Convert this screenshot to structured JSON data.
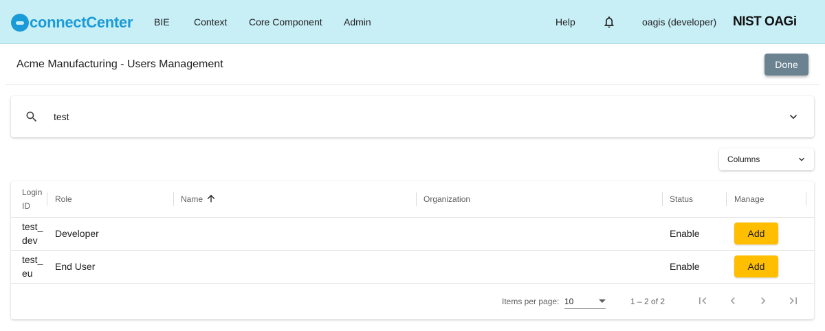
{
  "nav": {
    "logo_text": "connectCenter",
    "items": [
      "BIE",
      "Context",
      "Core Component",
      "Admin"
    ],
    "help": "Help",
    "user": "oagis (developer)",
    "brand": "NIST OAGi"
  },
  "page": {
    "title": "Acme Manufacturing - Users Management",
    "done_label": "Done"
  },
  "search": {
    "value": "test"
  },
  "columns_dropdown": {
    "label": "Columns"
  },
  "table": {
    "headers": {
      "login_id_line1": "Login",
      "login_id_line2": "ID",
      "role": "Role",
      "name": "Name",
      "organization": "Organization",
      "status": "Status",
      "manage": "Manage"
    },
    "sort": {
      "column": "Name",
      "direction": "ascending"
    },
    "rows": [
      {
        "login_line1": "test_",
        "login_line2": "dev",
        "role": "Developer",
        "name": "",
        "organization": "",
        "status": "Enable",
        "action": "Add"
      },
      {
        "login_line1": "test_",
        "login_line2": "eu",
        "role": "End User",
        "name": "",
        "organization": "",
        "status": "Enable",
        "action": "Add"
      }
    ]
  },
  "paginator": {
    "items_per_page_label": "Items per page:",
    "page_size": "10",
    "range": "1 – 2 of 2"
  },
  "colors": {
    "topbar": "#c8eef6",
    "brand_blue": "#1a9bd7",
    "done_button": "#6b8290",
    "add_button": "#ffbf00"
  },
  "icons": [
    "bell-icon",
    "search-icon",
    "chevron-down-icon",
    "arrow-up-icon",
    "first-page-icon",
    "previous-page-icon",
    "next-page-icon",
    "last-page-icon"
  ]
}
